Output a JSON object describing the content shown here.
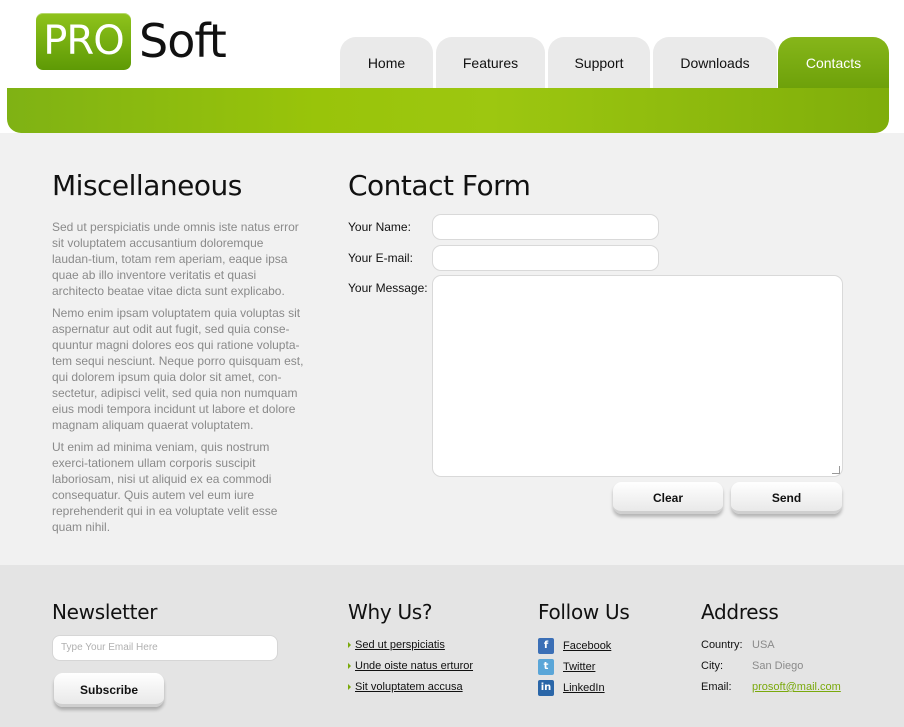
{
  "logo": {
    "pro": "PRO",
    "soft": "Soft"
  },
  "nav": {
    "tabs": [
      {
        "label": "Home"
      },
      {
        "label": "Features"
      },
      {
        "label": "Support"
      },
      {
        "label": "Downloads"
      },
      {
        "label": "Contacts",
        "active": true
      }
    ]
  },
  "misc": {
    "title": "Miscellaneous",
    "paragraphs": [
      "Sed ut perspiciatis unde omnis iste natus error sit voluptatem accusantium doloremque laudan-tium, totam rem aperiam, eaque ipsa quae ab illo inventore veritatis et quasi architecto beatae vitae dicta sunt explicabo.",
      "Nemo enim ipsam voluptatem quia voluptas sit aspernatur aut odit aut fugit, sed quia conse-quuntur magni dolores eos qui ratione volupta-tem sequi nesciunt. Neque porro quisquam est, qui dolorem ipsum quia dolor sit amet, con-sectetur, adipisci velit, sed quia non numquam eius modi tempora incidunt ut labore et dolore magnam aliquam quaerat voluptatem.",
      "Ut enim ad minima veniam, quis nostrum exerci-tationem ullam corporis suscipit laboriosam, nisi ut aliquid ex ea commodi consequatur. Quis autem vel eum iure reprehenderit qui in ea voluptate velit esse quam nihil."
    ]
  },
  "contact_form": {
    "title": "Contact Form",
    "name_label": "Your Name:",
    "email_label": "Your E-mail:",
    "message_label": "Your Message:",
    "name_value": "",
    "email_value": "",
    "message_value": "",
    "clear_label": "Clear",
    "send_label": "Send"
  },
  "newsletter": {
    "title": "Newsletter",
    "placeholder": "Type Your Email Here",
    "subscribe_label": "Subscribe"
  },
  "why_us": {
    "title": "Why Us?",
    "items": [
      "Sed ut perspiciatis",
      "Unde oiste natus erturor",
      "Sit voluptatem accusa"
    ]
  },
  "follow_us": {
    "title": "Follow Us",
    "items": [
      {
        "label": "Facebook",
        "icon": "facebook-icon",
        "color": "#3b6fb6"
      },
      {
        "label": "Twitter",
        "icon": "twitter-icon",
        "color": "#5aa6d8"
      },
      {
        "label": "LinkedIn",
        "icon": "linkedin-icon",
        "color": "#2a66a8"
      }
    ]
  },
  "address": {
    "title": "Address",
    "country_label": "Country:",
    "country_value": "USA",
    "city_label": "City:",
    "city_value": "San Diego",
    "email_label": "Email:",
    "email_value": "prosoft@mail.com"
  },
  "colors": {
    "accent": "#7aa90c",
    "tab_bg": "#eaeaea"
  }
}
